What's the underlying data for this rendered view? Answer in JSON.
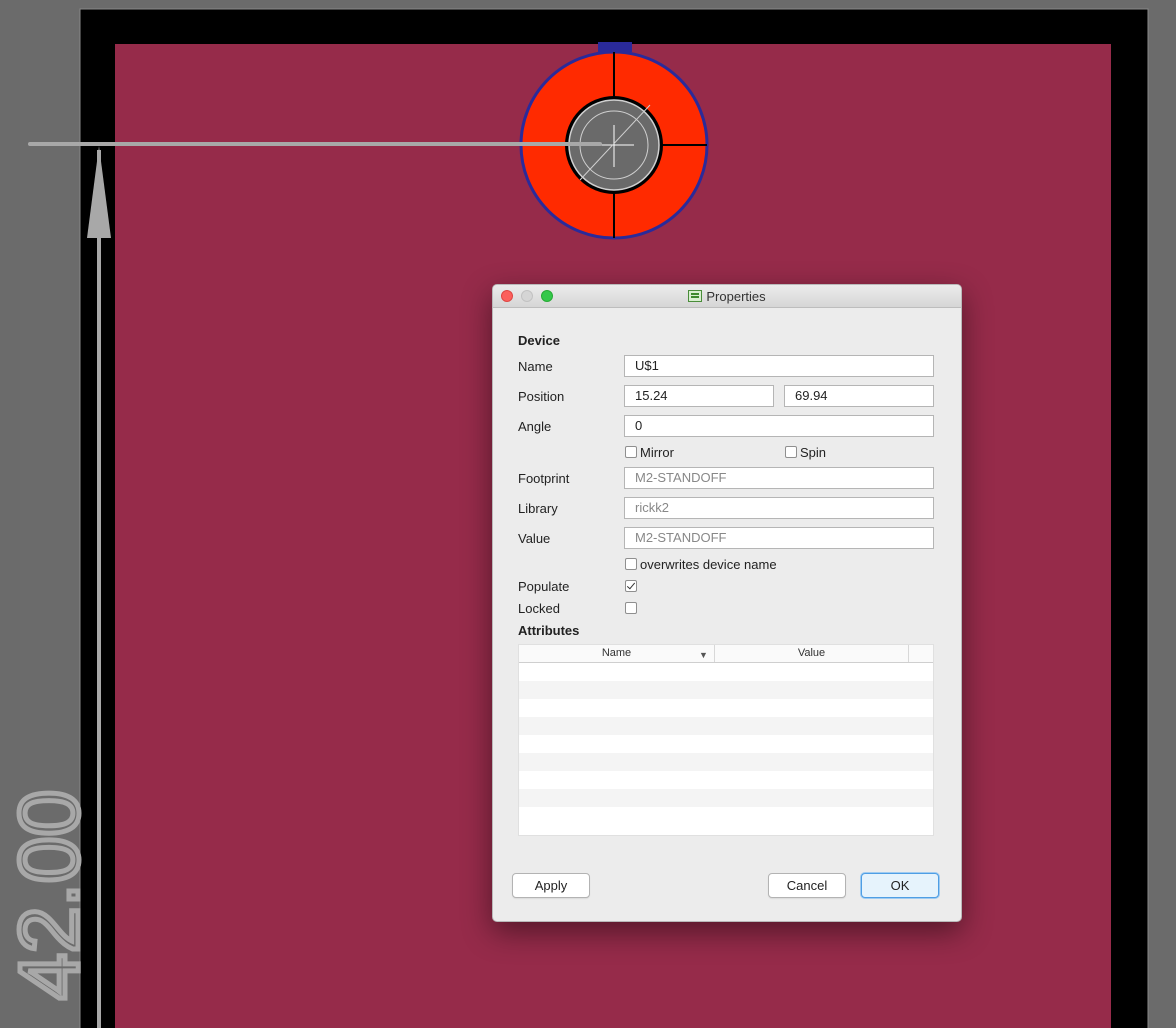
{
  "board": {
    "dimension_label": "42.00",
    "colors": {
      "background": "#6b6b6b",
      "frame": "#000000",
      "board_fill": "#962b4a",
      "pad": "#ff2a00",
      "pad_outline": "#2a2a9a",
      "dimension": "#a8a8a8"
    }
  },
  "dialog": {
    "title": "Properties",
    "section_device": "Device",
    "name_label": "Name",
    "name_value": "U$1",
    "position_label": "Position",
    "position_x": "15.24",
    "position_y": "69.94",
    "angle_label": "Angle",
    "angle_value": "0",
    "mirror_label": "Mirror",
    "mirror_checked": false,
    "spin_label": "Spin",
    "spin_checked": false,
    "footprint_label": "Footprint",
    "footprint_value": "M2-STANDOFF",
    "library_label": "Library",
    "library_value": "rickk2",
    "value_label": "Value",
    "value_value": "M2-STANDOFF",
    "overwrites_label": "overwrites device name",
    "overwrites_checked": false,
    "populate_label": "Populate",
    "populate_checked": true,
    "locked_label": "Locked",
    "locked_checked": false,
    "section_attributes": "Attributes",
    "attributes_columns": [
      "Name",
      "Value"
    ],
    "attributes_rows": [],
    "apply_label": "Apply",
    "cancel_label": "Cancel",
    "ok_label": "OK"
  }
}
